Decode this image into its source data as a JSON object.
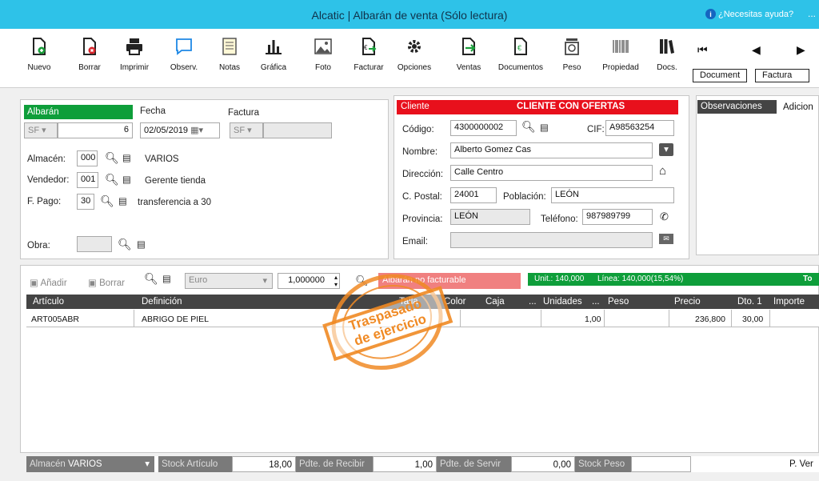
{
  "window": {
    "title": "Alcatic | Albarán de venta (Sólo lectura)",
    "help": "¿Necesitas ayuda?",
    "more": "..."
  },
  "toolbar": {
    "items": [
      {
        "label": "Nuevo",
        "icon": "new-document-icon"
      },
      {
        "label": "Borrar",
        "icon": "delete-document-icon"
      },
      {
        "label": "Imprimir",
        "icon": "printer-icon"
      },
      {
        "label": "Observ.",
        "icon": "comment-icon"
      },
      {
        "label": "Notas",
        "icon": "notes-icon"
      },
      {
        "label": "Gráfica",
        "icon": "bar-chart-icon"
      },
      {
        "label": "Foto",
        "icon": "photo-icon"
      },
      {
        "label": "Facturar",
        "icon": "invoice-icon"
      },
      {
        "label": "Opciones",
        "icon": "gear-icon"
      },
      {
        "label": "Ventas",
        "icon": "sales-export-icon"
      },
      {
        "label": "Documentos",
        "icon": "documents-icon"
      },
      {
        "label": "Peso",
        "icon": "scale-icon"
      },
      {
        "label": "Propiedad",
        "icon": "barcode-icon"
      },
      {
        "label": "Docs.",
        "icon": "library-icon"
      }
    ],
    "tabs": {
      "document": "Document",
      "factura": "Factura"
    }
  },
  "albaran": {
    "header": "Albarán",
    "fecha_label": "Fecha",
    "factura_label": "Factura",
    "serie": "SF",
    "numero": "6",
    "fecha": "02/05/2019",
    "fact_serie": "SF",
    "almacen_label": "Almacén:",
    "almacen_code": "000",
    "almacen_name": "VARIOS",
    "vendedor_label": "Vendedor:",
    "vendedor_code": "001",
    "vendedor_name": "Gerente tienda",
    "fpago_label": "F. Pago:",
    "fpago_code": "30",
    "fpago_name": "transferencia a 30",
    "obra_label": "Obra:"
  },
  "cliente": {
    "header": "Cliente",
    "offer": "CLIENTE CON OFERTAS",
    "codigo_label": "Código:",
    "codigo": "4300000002",
    "cif_label": "CIF:",
    "cif": "A98563254",
    "nombre_label": "Nombre:",
    "nombre": "Alberto Gomez Cas",
    "direccion_label": "Dirección:",
    "direccion": "Calle Centro",
    "cpostal_label": "C. Postal:",
    "cpostal": "24001",
    "poblacion_label": "Población:",
    "poblacion": "LEÓN",
    "provincia_label": "Provincia:",
    "provincia": "LEÓN",
    "telefono_label": "Teléfono:",
    "telefono": "987989799",
    "email_label": "Email:"
  },
  "obs_tabs": {
    "observaciones": "Observaciones",
    "adicional": "Adicion"
  },
  "lines_toolbar": {
    "add": "Añadir",
    "delete": "Borrar",
    "currency": "Euro",
    "rate": "1,000000",
    "nofact": "Albarán no facturable",
    "unit": "Unit.: 140,000",
    "linea": "Línea: 140,000(15,54%)",
    "to": "To"
  },
  "stamp": {
    "line1": "Traspasado",
    "line2": "de ejercicio"
  },
  "grid": {
    "headers": [
      "Artículo",
      "Definición",
      "Talla",
      "Color",
      "Caja",
      "...",
      "Unidades",
      "...",
      "Peso",
      "Precio",
      "Dto. 1",
      "Importe"
    ],
    "rows": [
      {
        "articulo": "ART005ABR",
        "definicion": "ABRIGO DE PIEL",
        "unidades": "1,00",
        "precio": "236,800",
        "dto": "30,00"
      }
    ]
  },
  "footer": {
    "almacen_label": "Almacén",
    "almacen": "VARIOS",
    "stock_label": "Stock Artículo",
    "stock": "18,00",
    "recibir_label": "Pdte. de Recibir",
    "recibir": "1,00",
    "servir_label": "Pdte. de Servir",
    "servir": "0,00",
    "peso_label": "Stock Peso",
    "pver": "P. Ver"
  }
}
